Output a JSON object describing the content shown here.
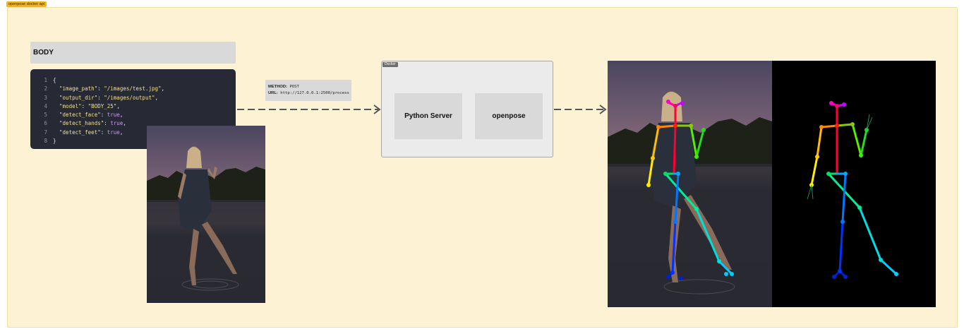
{
  "frame": {
    "label": "openpose docker api"
  },
  "body_panel": {
    "title": "BODY"
  },
  "code": {
    "lines": [
      {
        "n": "1",
        "tokens": [
          [
            "p",
            "{"
          ]
        ]
      },
      {
        "n": "2",
        "tokens": [
          [
            "p",
            "  "
          ],
          [
            "k",
            "\"image_path\""
          ],
          [
            "p",
            ": "
          ],
          [
            "s",
            "\"/images/test.jpg\""
          ],
          [
            "p",
            ","
          ]
        ]
      },
      {
        "n": "3",
        "tokens": [
          [
            "p",
            "  "
          ],
          [
            "k",
            "\"output_dir\""
          ],
          [
            "p",
            ": "
          ],
          [
            "s",
            "\"/images/output\""
          ],
          [
            "p",
            ","
          ]
        ]
      },
      {
        "n": "4",
        "tokens": [
          [
            "p",
            "  "
          ],
          [
            "k",
            "\"model\""
          ],
          [
            "p",
            ": "
          ],
          [
            "s",
            "\"BODY_25\""
          ],
          [
            "p",
            ","
          ]
        ]
      },
      {
        "n": "5",
        "tokens": [
          [
            "p",
            "  "
          ],
          [
            "k",
            "\"detect_face\""
          ],
          [
            "p",
            ": "
          ],
          [
            "b",
            "true"
          ],
          [
            "p",
            ","
          ]
        ]
      },
      {
        "n": "6",
        "tokens": [
          [
            "p",
            "  "
          ],
          [
            "k",
            "\"detect_hands\""
          ],
          [
            "p",
            ": "
          ],
          [
            "b",
            "true"
          ],
          [
            "p",
            ","
          ]
        ]
      },
      {
        "n": "7",
        "tokens": [
          [
            "p",
            "  "
          ],
          [
            "k",
            "\"detect_feet\""
          ],
          [
            "p",
            ": "
          ],
          [
            "b",
            "true"
          ],
          [
            "p",
            ","
          ]
        ]
      },
      {
        "n": "8",
        "tokens": [
          [
            "p",
            "}"
          ]
        ]
      }
    ]
  },
  "request": {
    "method_key": "METHOD:",
    "method_value": "POST",
    "url_key": "URL:",
    "url_value": "http://127.0.0.1:2500/process"
  },
  "docker": {
    "tag": "Docker",
    "services": [
      {
        "label": "Python Server"
      },
      {
        "label": "openpose"
      }
    ]
  },
  "colors": {
    "frame_tag": "#f5b31a",
    "section_bg": "#fef2d5",
    "code_bg": "#272a35",
    "panel_grey": "#d9d9d9",
    "arrow": "#555555"
  }
}
